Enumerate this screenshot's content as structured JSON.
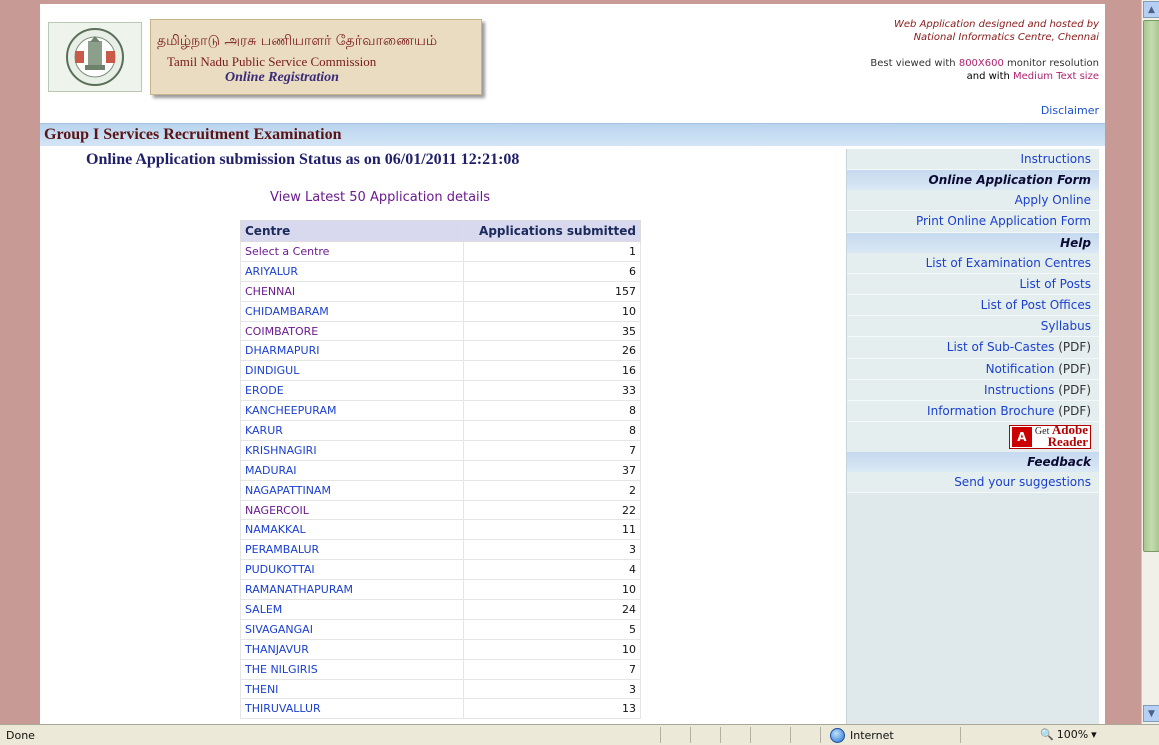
{
  "header": {
    "tamil_title": "தமிழ்நாடு அரசு பணியாளர் தேர்வாணையம்",
    "english_title": "Tamil Nadu Public Service Commission",
    "subtitle": "Online Registration",
    "designed_line1": "Web Application designed and hosted by",
    "designed_line2": "National Informatics Centre, Chennai",
    "best_viewed_prefix": "Best viewed with ",
    "resolution": "800X600",
    "best_viewed_mid": " monitor resolution",
    "and_with": "and with ",
    "text_size": "Medium Text size",
    "disclaimer": "Disclaimer"
  },
  "page_title": "Group I Services Recruitment Examination",
  "status_heading": "Online Application submission Status as on 06/01/2011 12:21:08",
  "view_latest_link": "View Latest 50 Application details",
  "table": {
    "col_centre": "Centre",
    "col_apps": "Applications submitted",
    "rows": [
      {
        "centre": "Select a Centre",
        "count": "1",
        "visited": true
      },
      {
        "centre": "ARIYALUR",
        "count": "6",
        "visited": false
      },
      {
        "centre": "CHENNAI",
        "count": "157",
        "visited": true
      },
      {
        "centre": "CHIDAMBARAM",
        "count": "10",
        "visited": false
      },
      {
        "centre": "COIMBATORE",
        "count": "35",
        "visited": true
      },
      {
        "centre": "DHARMAPURI",
        "count": "26",
        "visited": false
      },
      {
        "centre": "DINDIGUL",
        "count": "16",
        "visited": false
      },
      {
        "centre": "ERODE",
        "count": "33",
        "visited": false
      },
      {
        "centre": "KANCHEEPURAM",
        "count": "8",
        "visited": false
      },
      {
        "centre": "KARUR",
        "count": "8",
        "visited": false
      },
      {
        "centre": "KRISHNAGIRI",
        "count": "7",
        "visited": false
      },
      {
        "centre": "MADURAI",
        "count": "37",
        "visited": false
      },
      {
        "centre": "NAGAPATTINAM",
        "count": "2",
        "visited": false
      },
      {
        "centre": "NAGERCOIL",
        "count": "22",
        "visited": true
      },
      {
        "centre": "NAMAKKAL",
        "count": "11",
        "visited": false
      },
      {
        "centre": "PERAMBALUR",
        "count": "3",
        "visited": false
      },
      {
        "centre": "PUDUKOTTAI",
        "count": "4",
        "visited": false
      },
      {
        "centre": "RAMANATHAPURAM",
        "count": "10",
        "visited": false
      },
      {
        "centre": "SALEM",
        "count": "24",
        "visited": false
      },
      {
        "centre": "SIVAGANGAI",
        "count": "5",
        "visited": false
      },
      {
        "centre": "THANJAVUR",
        "count": "10",
        "visited": false
      },
      {
        "centre": "THE NILGIRIS",
        "count": "7",
        "visited": false
      },
      {
        "centre": "THENI",
        "count": "3",
        "visited": false
      },
      {
        "centre": "THIRUVALLUR",
        "count": "13",
        "visited": false
      }
    ]
  },
  "sidebar": {
    "instructions": "Instructions",
    "online_form_head": "Online Application Form",
    "apply_online": "Apply Online",
    "print_form": "Print Online Application Form",
    "help_head": "Help",
    "exam_centres": "List of Examination Centres",
    "posts": "List of Posts",
    "post_offices": "List of Post Offices",
    "syllabus": "Syllabus",
    "subcastes": "List of Sub-Castes",
    "notification": "Notification",
    "instructions_pdf": "Instructions",
    "brochure": "Information Brochure",
    "pdf_suffix": " (PDF)",
    "adobe_get": "Get",
    "adobe_name": "Adobe",
    "adobe_reader": "Reader",
    "feedback_head": "Feedback",
    "suggestions": "Send your suggestions"
  },
  "statusbar": {
    "status": "Done",
    "zone": "Internet",
    "zoom": "100%"
  },
  "colors": {
    "outer_bg": "#c89a96",
    "title_bar": "#c6d9ef",
    "link": "#1a3fd0",
    "visited_link": "#6b1a8f",
    "sidebar_bg": "#dfe8ea"
  }
}
